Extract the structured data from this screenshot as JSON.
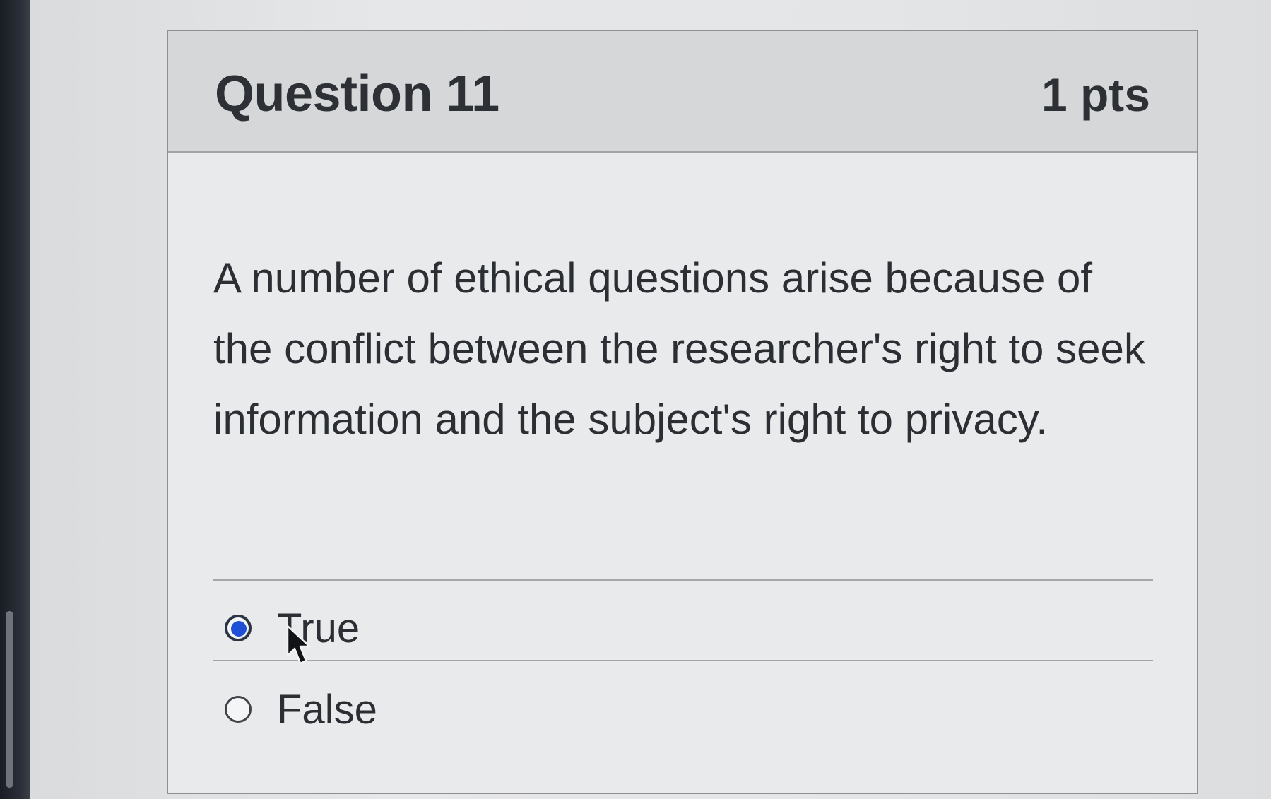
{
  "question": {
    "title": "Question 11",
    "points": "1 pts",
    "text": "A number of ethical questions arise because of the conflict between the researcher's right to seek information and the subject's right to privacy."
  },
  "answers": [
    {
      "label": "True",
      "selected": true
    },
    {
      "label": "False",
      "selected": false
    }
  ],
  "colors": {
    "radio_selected": "#1f4fd6",
    "text": "#2b2e33"
  },
  "icons": {
    "cursor": "mouse-pointer-icon"
  }
}
